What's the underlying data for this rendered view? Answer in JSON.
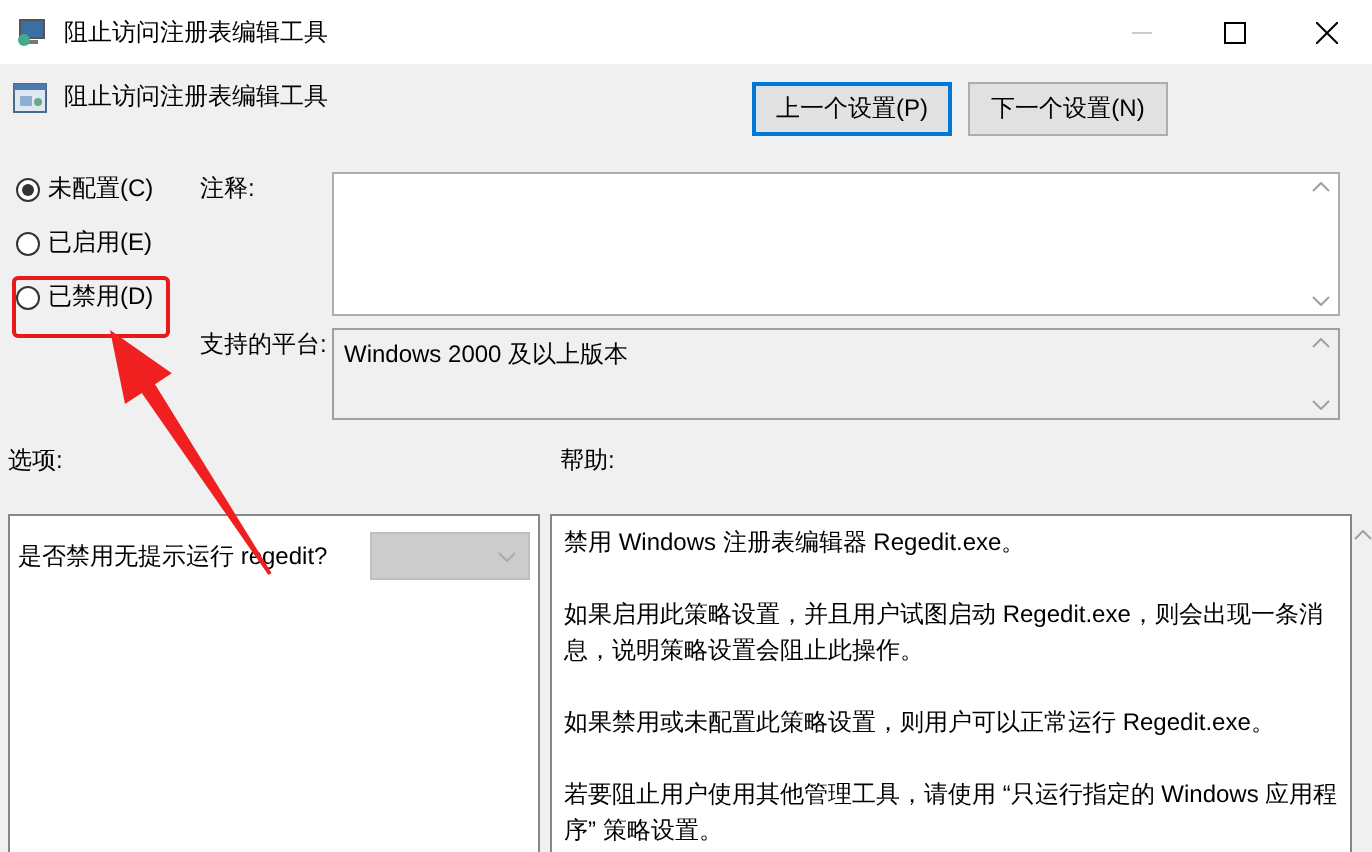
{
  "window": {
    "title": "阻止访问注册表编辑工具"
  },
  "header": {
    "title": "阻止访问注册表编辑工具"
  },
  "buttons": [
    {
      "label": "上一个设置(P)",
      "focused": true
    },
    {
      "label": "下一个设置(N)",
      "focused": false
    }
  ],
  "states": [
    {
      "label": "未配置(C)",
      "selected": true
    },
    {
      "label": "已启用(E)",
      "selected": false
    },
    {
      "label": "已禁用(D)",
      "selected": false
    }
  ],
  "comment": {
    "label": "注释:"
  },
  "platform": {
    "label": "支持的平台:",
    "value": "Windows 2000 及以上版本"
  },
  "options": {
    "label": "选项:",
    "rows": [
      {
        "label": "是否禁用无提示运行 regedit?",
        "disabled": true
      }
    ]
  },
  "help": {
    "label": "帮助:",
    "paragraphs": [
      "禁用 Windows 注册表编辑器 Regedit.exe。",
      "如果启用此策略设置，并且用户试图启动 Regedit.exe，则会出现一条消息，说明策略设置会阻止此操作。",
      "如果禁用或未配置此策略设置，则用户可以正常运行 Regedit.exe。",
      "若要阻止用户使用其他管理工具，请使用 “只运行指定的 Windows 应用程序” 策略设置。"
    ]
  }
}
